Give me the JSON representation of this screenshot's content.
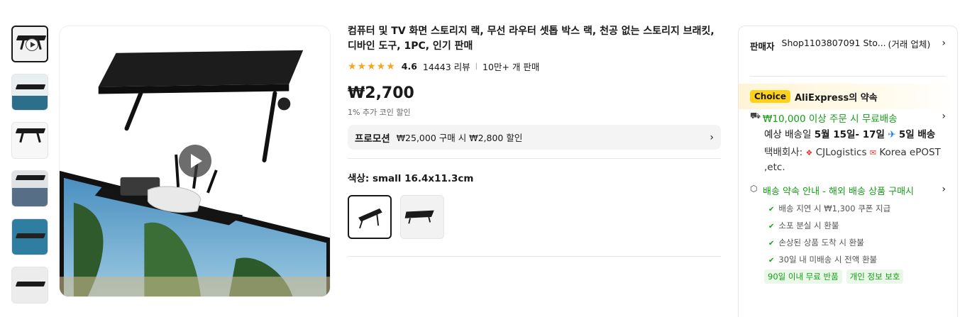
{
  "gallery": {
    "thumbnails": [
      "video-thumb",
      "image-2",
      "image-3",
      "image-4",
      "image-5",
      "image-6"
    ]
  },
  "product": {
    "title": "컴퓨터 및 TV 화면 스토리지 랙, 무선 라우터 셋톱 박스 랙, 천공 없는 스토리지 브래킷, 디바인 도구, 1PC, 인기 판매",
    "stars": "★★★★★",
    "rating": "4.6",
    "reviews": "14443 리뷰",
    "divider": "|",
    "sold": "10만+ 개 판매",
    "price": "₩2,700",
    "coin_note": "1% 추가 코인 할인",
    "promo_tag": "프로모션",
    "promo_text": "₩25,000 구매 시 ₩2,800 할인",
    "color_label": "색상: small 16.4x11.3cm"
  },
  "panel": {
    "seller_label": "판매자",
    "seller_name": "Shop1103807091 Sto...",
    "seller_type": "(거래 업체)",
    "choice_badge": "Choice",
    "choice_text": "AliExpress의 약속",
    "free_ship": "₩10,000 이상 주문 시 무료배송",
    "delivery_prefix": "예상 배송일 ",
    "delivery_date": "5월 15일- 17일",
    "delivery_fast": "5일 배송",
    "carrier_label": "택배회사:",
    "carrier_1": "CJLogistics",
    "carrier_2": "Korea ePOST ,etc.",
    "promise_title": "배송 약속 안내 - 해외 배송 상품 구매시",
    "checks": [
      "배송 지연 시 ₩1,300 쿠폰 지급",
      "소포 분실 시 환불",
      "손상된 상품 도착 시 환불",
      "30일 내 미배송 시 전액 환불"
    ],
    "tags": [
      "90일 이내 무료 반품",
      "개인 정보 보호"
    ]
  },
  "colors": {
    "green": "#14a014",
    "star": "#f5a623",
    "choice": "#ffd11a"
  }
}
